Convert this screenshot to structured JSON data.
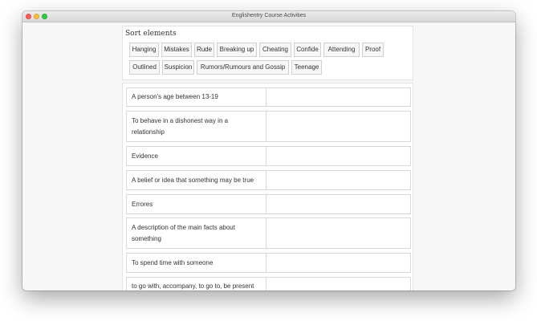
{
  "window": {
    "title": "Englishentry Course Activities"
  },
  "sort": {
    "title": "Sort elements",
    "chips": [
      "Hanging",
      "Mistakes",
      "Rude",
      "Breaking up",
      "Cheating",
      "Confide",
      "Attending",
      "Proof",
      "Outlined",
      "Suspicion",
      "Rumors/Rumours and Gossip",
      "Teenage"
    ]
  },
  "definitions": [
    "A person's age between 13-19",
    "To behave in a dishonest way in a relationship",
    "Evidence",
    "A belief or idea that something may be true",
    "Errores",
    "A description of the main facts about something",
    "To spend time with someone",
    "to go with, accompany, to go to, be present"
  ]
}
